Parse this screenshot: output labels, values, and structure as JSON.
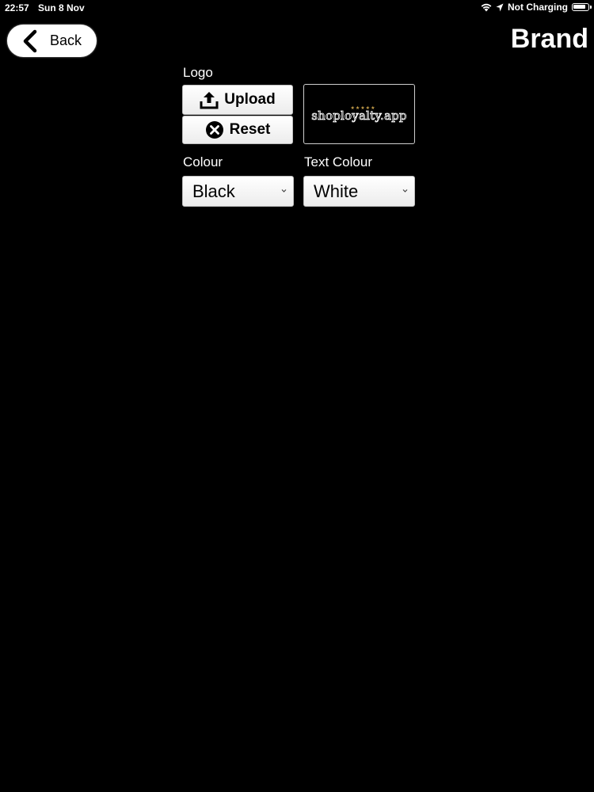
{
  "status_bar": {
    "time": "22:57",
    "date": "Sun 8 Nov",
    "charging": "Not Charging",
    "icons": [
      "wifi-icon",
      "location-arrow-icon",
      "battery-icon"
    ]
  },
  "nav": {
    "back_label": "Back",
    "title": "Brand"
  },
  "logo": {
    "label": "Logo",
    "upload_label": "Upload",
    "reset_label": "Reset",
    "preview_text": "shoployalty.app",
    "preview_stars": "★★★★★",
    "stars_color": "#c8a04a"
  },
  "colour": {
    "label": "Colour",
    "selected": "Black"
  },
  "text_colour": {
    "label": "Text Colour",
    "selected": "White"
  },
  "colors": {
    "background": "#000000",
    "foreground": "#ffffff"
  }
}
